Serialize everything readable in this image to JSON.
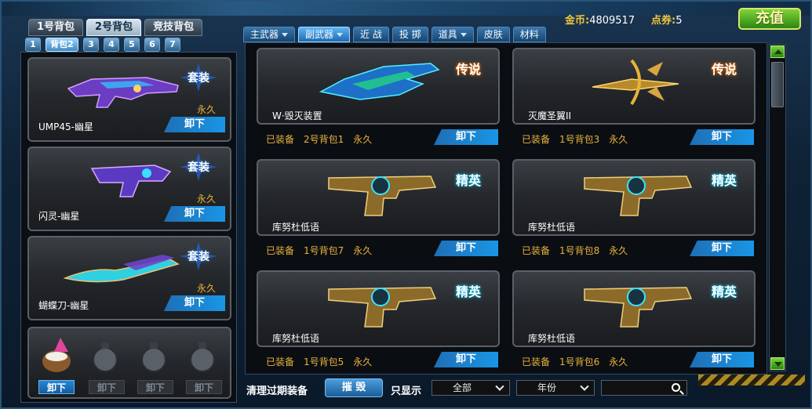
{
  "bag_tabs": [
    {
      "label": "1号背包",
      "active": false
    },
    {
      "label": "2号背包",
      "active": true
    },
    {
      "label": "竞技背包",
      "active": false
    }
  ],
  "sub_tabs": [
    "1",
    "背包2",
    "3",
    "4",
    "5",
    "6",
    "7"
  ],
  "currency": {
    "gold_label": "金币:",
    "gold_value": "4809517",
    "points_label": "点券:",
    "points_value": "5",
    "recharge_label": "充值"
  },
  "category_tabs": [
    {
      "label": "主武器",
      "dropdown": true,
      "active": false
    },
    {
      "label": "副武器",
      "dropdown": true,
      "active": true
    },
    {
      "label": "近 战",
      "dropdown": false,
      "active": false
    },
    {
      "label": "投 掷",
      "dropdown": false,
      "active": false
    },
    {
      "label": "道具",
      "dropdown": true,
      "active": false
    },
    {
      "label": "皮肤",
      "dropdown": false,
      "active": false
    },
    {
      "label": "材料",
      "dropdown": false,
      "active": false
    }
  ],
  "loadout": [
    {
      "name": "UMP45-幽星",
      "badge": "套装",
      "duration": "永久",
      "button": "卸下"
    },
    {
      "name": "闪灵-幽星",
      "badge": "套装",
      "duration": "永久",
      "button": "卸下"
    },
    {
      "name": "蝴蝶刀-幽星",
      "badge": "套装",
      "duration": "永久",
      "button": "卸下"
    }
  ],
  "grenades": {
    "buttons": [
      "卸下",
      "卸下",
      "卸下",
      "卸下"
    ]
  },
  "items": [
    {
      "name": "W·毁灭装置",
      "rarity": "传说",
      "equipped_label": "已装备",
      "bag": "2号背包1",
      "duration": "永久",
      "button": "卸下"
    },
    {
      "name": "灭魔圣翼II",
      "rarity": "传说",
      "equipped_label": "已装备",
      "bag": "1号背包3",
      "duration": "永久",
      "button": "卸下"
    },
    {
      "name": "库努杜低语",
      "rarity": "精英",
      "equipped_label": "已装备",
      "bag": "1号背包7",
      "duration": "永久",
      "button": "卸下"
    },
    {
      "name": "库努杜低语",
      "rarity": "精英",
      "equipped_label": "已装备",
      "bag": "1号背包8",
      "duration": "永久",
      "button": "卸下"
    },
    {
      "name": "库努杜低语",
      "rarity": "精英",
      "equipped_label": "已装备",
      "bag": "1号背包5",
      "duration": "永久",
      "button": "卸下"
    },
    {
      "name": "库努杜低语",
      "rarity": "精英",
      "equipped_label": "已装备",
      "bag": "1号背包6",
      "duration": "永久",
      "button": "卸下"
    }
  ],
  "bottom": {
    "clean_label": "清理过期装备",
    "destroy_label": "摧 毁",
    "filter_label": "只显示",
    "filter_all": "全部",
    "filter_year": "年份",
    "search_value": ""
  },
  "colors": {
    "accent": "#1996e6",
    "gold": "#e8b23a",
    "recharge": "#2b8612"
  }
}
